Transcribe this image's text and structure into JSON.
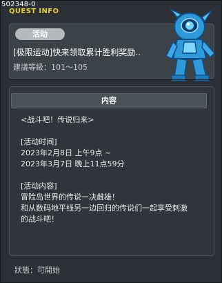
{
  "header": {
    "quest_id": "502348-0",
    "title": "QUEST INFO"
  },
  "event": {
    "tag_label": "活动",
    "title": "[极限运动]快来领取累计胜利奖励..",
    "level_label": "建議等級：101～105"
  },
  "content": {
    "header": "内容",
    "lines": [
      "<战斗吧！传说归来>",
      "",
      "[活动时间]",
      "2023年2月8日 上午9点 ~",
      "2023年3月7日 晚上11点59分",
      "",
      "[活动内容]",
      "冒险岛世界的传说一决雌雄！",
      "和从数码地平线另一边回归的传说们一起享受刺激",
      "的战斗吧！"
    ]
  },
  "status": {
    "text": "狀態：可開始"
  },
  "icons": {
    "robot": "blue-robot-npc-icon"
  },
  "colors": {
    "title_yellow": "#e7cf2b",
    "robot_blue": "#2f9ad9"
  }
}
